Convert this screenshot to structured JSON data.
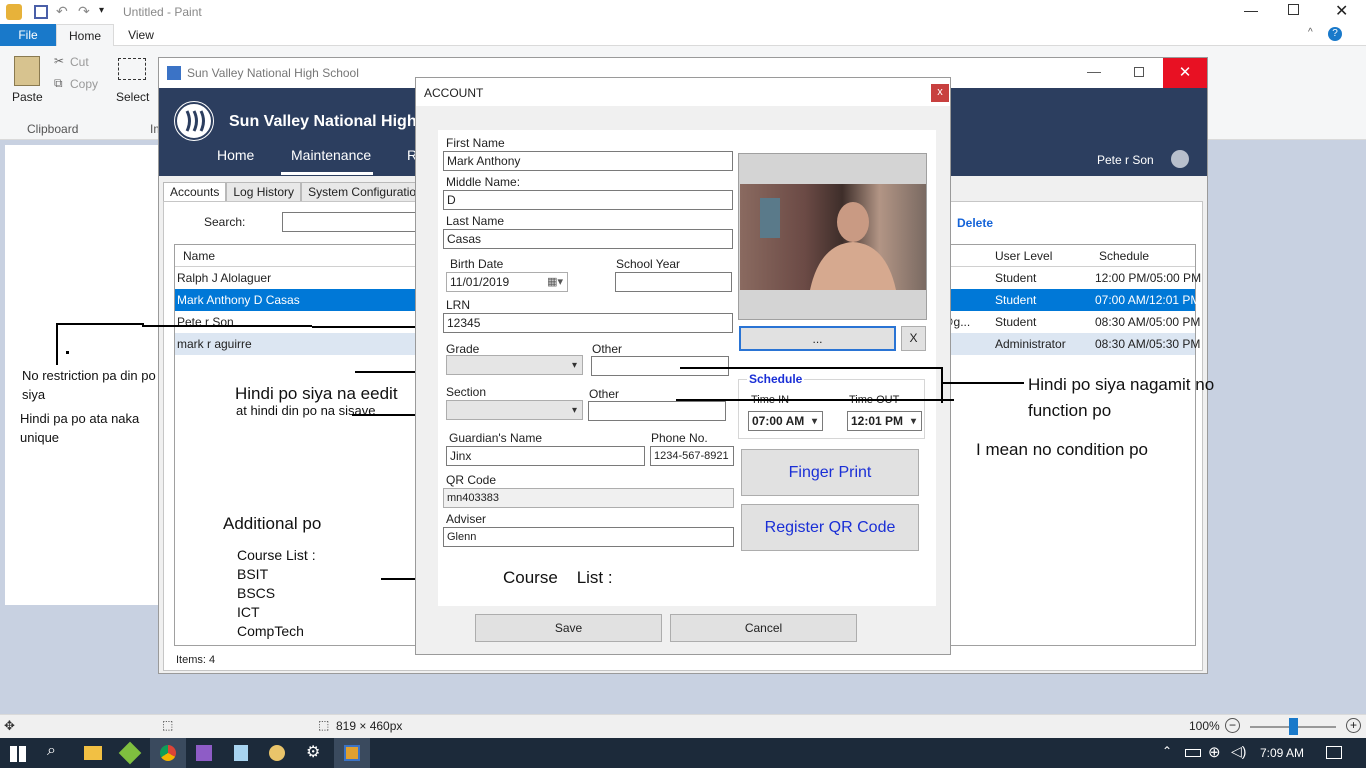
{
  "paint": {
    "title": "Untitled - Paint",
    "tabs": [
      "File",
      "Home",
      "View"
    ],
    "ribbon": {
      "paste": "Paste",
      "cut": "Cut",
      "copy": "Copy",
      "select": "Select",
      "clipboard_group": "Clipboard",
      "image_group": "Im"
    },
    "status": {
      "size": "819 × 460px",
      "zoom": "100%"
    }
  },
  "app": {
    "window_title": "Sun Valley National High School",
    "school_name": "Sun Valley National High Sc",
    "nav": [
      "Home",
      "Maintenance",
      "R"
    ],
    "user": "Pete r Son",
    "tabs": [
      "Accounts",
      "Log History",
      "System Configuration"
    ],
    "search_label": "Search:",
    "delete_label": "Delete",
    "columns": {
      "name": "Name",
      "user_level": "User Level",
      "schedule": "Schedule"
    },
    "rows": [
      {
        "name": "Ralph J Alolaguer",
        "extra": "",
        "level": "Student",
        "schedule": "12:00 PM/05:00 PM",
        "selected": false
      },
      {
        "name": "Mark Anthony D Casas",
        "extra": "",
        "level": "Student",
        "schedule": "07:00 AM/12:01 PM",
        "selected": true
      },
      {
        "name": "Pete r Son",
        "extra": "26@g...",
        "level": "Student",
        "schedule": "08:30 AM/05:00 PM",
        "selected": false
      },
      {
        "name": "mark r aguirre",
        "extra": "",
        "level": "Administrator",
        "schedule": "08:30 AM/05:30 PM",
        "selected": false
      }
    ],
    "items_count": "Items: 4"
  },
  "dialog": {
    "title": "ACCOUNT",
    "close": "x",
    "first_name_label": "First Name",
    "first_name": "Mark Anthony",
    "middle_name_label": "Middle Name:",
    "middle_name": "D",
    "last_name_label": "Last Name",
    "last_name": "Casas",
    "birth_date_label": "Birth Date",
    "birth_date": "11/01/2019",
    "school_year_label": "School Year",
    "school_year": "",
    "lrn_label": "LRN",
    "lrn": "12345",
    "grade_label": "Grade",
    "other_label": "Other",
    "section_label": "Section",
    "other2_label": "Other",
    "guardian_label": "Guardian's Name",
    "guardian": "Jinx",
    "phone_label": "Phone No.",
    "phone": "1234-567-8921",
    "qr_label": "QR Code",
    "qr": "mn403383",
    "adviser_label": "Adviser",
    "adviser": "Glenn",
    "browse_button": "...",
    "clear_button": "X",
    "schedule_label": "Schedule",
    "time_in_label": "Time IN",
    "time_in": "07:00 AM",
    "time_out_label": "Time OUT",
    "time_out": "12:01 PM",
    "finger_print": "Finger Print",
    "register_qr": "Register QR Code",
    "save": "Save",
    "cancel": "Cancel"
  },
  "annotations": {
    "no_restriction": "No restriction pa din po siya",
    "not_unique": "Hindi pa po ata naka unique",
    "not_editable": "Hindi po siya na eedit",
    "not_saved": "at hindi din po na sisave",
    "not_used": "Hindi po siya nagamit no function po",
    "no_condition": "I mean no condition po",
    "additional": "Additional po",
    "course_list_title": "Course List :",
    "courses": [
      "BSIT",
      "BSCS",
      "ICT",
      "CompTech"
    ],
    "course_list_label": "Course    List :"
  },
  "taskbar": {
    "time": "7:09 AM"
  }
}
